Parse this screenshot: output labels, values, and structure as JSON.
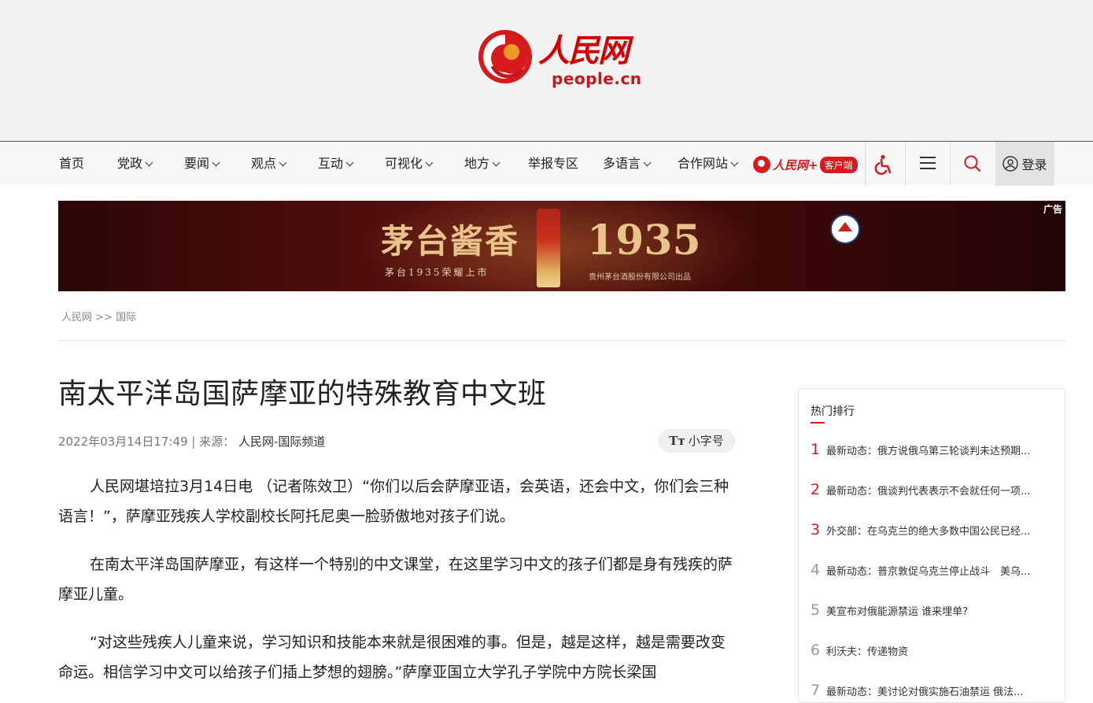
{
  "header": {
    "logo_cn": "人民网",
    "logo_en": "people.cn"
  },
  "nav": {
    "items": [
      {
        "label": "首页",
        "dropdown": false
      },
      {
        "label": "党政",
        "dropdown": true
      },
      {
        "label": "要闻",
        "dropdown": true
      },
      {
        "label": "观点",
        "dropdown": true
      },
      {
        "label": "互动",
        "dropdown": true
      },
      {
        "label": "可视化",
        "dropdown": true
      },
      {
        "label": "地方",
        "dropdown": true
      },
      {
        "label": "举报专区",
        "dropdown": false
      },
      {
        "label": "多语言",
        "dropdown": true
      },
      {
        "label": "合作网站",
        "dropdown": true
      }
    ],
    "app_name": "人民网+",
    "app_tag": "客户端",
    "login_label": "登录"
  },
  "ad": {
    "title": "茅台酱香",
    "subtitle": "茅台1935荣耀上市",
    "year": "1935",
    "maker": "贵州茅台酒股份有限公司出品",
    "label": "广告"
  },
  "breadcrumb": {
    "home": "人民网",
    "sep": ">>",
    "section": "国际"
  },
  "article": {
    "title": "南太平洋岛国萨摩亚的特殊教育中文班",
    "datetime": "2022年03月14日17:49",
    "source_label": "| 来源：",
    "source": "人民网-国际频道",
    "font_toggle_icon": "Tт",
    "font_toggle_label": "小字号",
    "paragraphs": [
      "人民网堪培拉3月14日电 （记者陈效卫）“你们以后会萨摩亚语，会英语，还会中文，你们会三种语言！”，萨摩亚残疾人学校副校长阿托尼奥一脸骄傲地对孩子们说。",
      "在南太平洋岛国萨摩亚，有这样一个特别的中文课堂，在这里学习中文的孩子们都是身有残疾的萨摩亚儿童。",
      "“对这些残疾人儿童来说，学习知识和技能本来就是很困难的事。但是，越是这样，越是需要改变命运。相信学习中文可以给孩子们插上梦想的翅膀。”萨摩亚国立大学孔子学院中方院长梁国"
    ]
  },
  "sidebar": {
    "heading": "热门排行",
    "items": [
      {
        "rank": "1",
        "text": "最新动态：俄方说俄乌第三轮谈判未达预期..."
      },
      {
        "rank": "2",
        "text": "最新动态：俄谈判代表表示不会就任何一项..."
      },
      {
        "rank": "3",
        "text": "外交部：在乌克兰的绝大多数中国公民已经..."
      },
      {
        "rank": "4",
        "text": "最新动态：普京敦促乌克兰停止战斗　美乌..."
      },
      {
        "rank": "5",
        "text": "美宣布对俄能源禁运 谁来埋单?"
      },
      {
        "rank": "6",
        "text": "利沃夫：传递物资"
      },
      {
        "rank": "7",
        "text": "最新动态：美讨论对俄实施石油禁运 俄法..."
      }
    ],
    "rank_colors": {
      "top": "#d71a1b",
      "rest": "#999999"
    }
  }
}
